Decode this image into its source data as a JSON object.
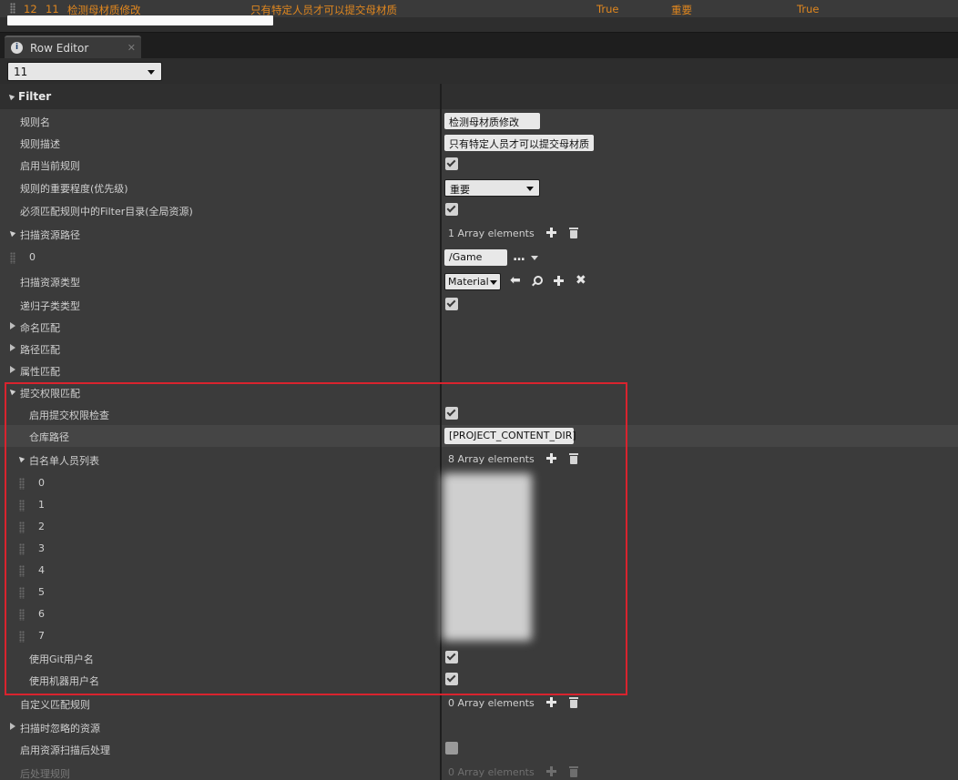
{
  "table_row": {
    "index": "12",
    "row_name": "11",
    "rule_name": "检测母材质修改",
    "description": "只有特定人员才可以提交母材质",
    "enabled": "True",
    "priority": "重要",
    "match_filter": "True"
  },
  "colors": {
    "accent_orange": "#e0871f",
    "highlight_red": "#d9232e",
    "panel_bg": "#3b3b3b"
  },
  "tab": {
    "label": "Row Editor",
    "icon": "row-editor-icon"
  },
  "row_selector": {
    "value": "11"
  },
  "category": {
    "title": "Filter"
  },
  "properties": {
    "rule_name": {
      "label": "规则名",
      "value": "检测母材质修改"
    },
    "rule_desc": {
      "label": "规则描述",
      "value": "只有特定人员才可以提交母材质"
    },
    "enable_rule": {
      "label": "启用当前规则",
      "checked": true
    },
    "priority": {
      "label": "规则的重要程度(优先级)",
      "value": "重要"
    },
    "must_match_filter": {
      "label": "必须匹配规则中的Filter目录(全局资源)",
      "checked": true
    },
    "scan_paths": {
      "label": "扫描资源路径",
      "count": "1 Array elements",
      "items": [
        {
          "index": "0",
          "value": "/Game"
        }
      ]
    },
    "scan_asset_type": {
      "label": "扫描资源类型",
      "value": "Material"
    },
    "recursive_subclass": {
      "label": "递归子类类型",
      "checked": true
    },
    "name_match": {
      "label": "命名匹配"
    },
    "path_match": {
      "label": "路径匹配"
    },
    "property_match": {
      "label": "属性匹配"
    },
    "commit_permission": {
      "label": "提交权限匹配",
      "enable_check": {
        "label": "启用提交权限检查",
        "checked": true
      },
      "repo_path": {
        "label": "仓库路径",
        "value": "[PROJECT_CONTENT_DIR]"
      },
      "whitelist": {
        "label": "白名单人员列表",
        "count": "8 Array elements",
        "indices": [
          "0",
          "1",
          "2",
          "3",
          "4",
          "5",
          "6",
          "7"
        ]
      },
      "use_git_user": {
        "label": "使用Git用户名",
        "checked": true
      },
      "use_machine_user": {
        "label": "使用机器用户名",
        "checked": true
      }
    },
    "custom_rules": {
      "label": "自定义匹配规则",
      "count": "0 Array elements"
    },
    "scan_ignored": {
      "label": "扫描时忽略的资源"
    },
    "post_process_enable": {
      "label": "启用资源扫描后处理",
      "checked": false
    },
    "post_process_rules": {
      "label": "后处理规则",
      "count": "0 Array elements"
    }
  }
}
